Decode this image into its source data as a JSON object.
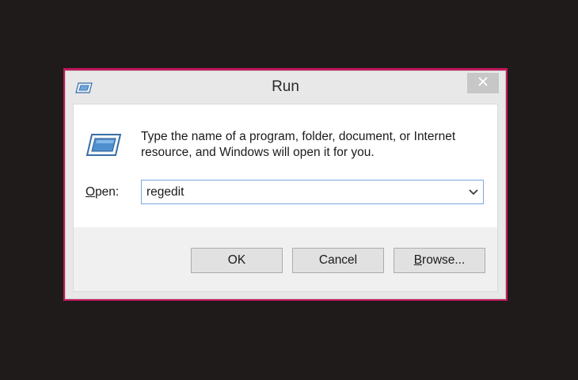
{
  "window": {
    "title": "Run",
    "close_icon": "close-icon"
  },
  "content": {
    "description": "Type the name of a program, folder, document, or Internet resource, and Windows will open it for you.",
    "open_label_first": "O",
    "open_label_rest": "pen:",
    "open_value": "regedit"
  },
  "buttons": {
    "ok_label": "OK",
    "cancel_label": "Cancel",
    "browse_first": "B",
    "browse_rest": "rowse..."
  },
  "colors": {
    "accent_background": "#c2185b",
    "desktop_background": "#1f1b1b",
    "input_border": "#7aa7d8"
  }
}
